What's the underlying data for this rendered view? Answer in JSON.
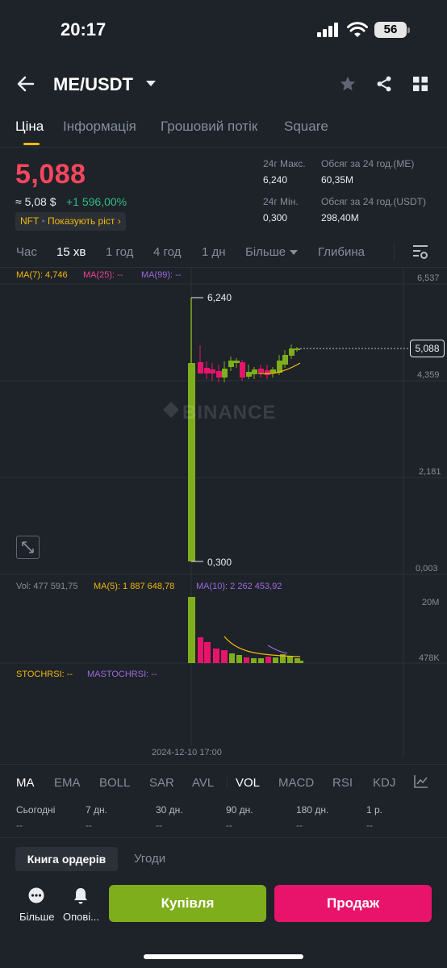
{
  "status": {
    "time": "20:17",
    "battery": "56"
  },
  "header": {
    "pair": "ME/USDT"
  },
  "tabs": [
    "Ціна",
    "Інформація",
    "Грошовий потік",
    "Square"
  ],
  "price": {
    "last": "5,088",
    "fiat": "≈ 5,08 $",
    "change": "+1 596,00%",
    "nft_tag": "NFT",
    "nft_link": "Показують ріст",
    "color_down": "#f6465d",
    "color_up": "#2ebd85"
  },
  "stats": {
    "high_label": "24г Макс.",
    "high_value": "6,240",
    "low_label": "24г Мін.",
    "low_value": "0,300",
    "vol_me_label": "Обсяг за 24 год.(ME)",
    "vol_me_value": "60,35M",
    "vol_usdt_label": "Обсяг за 24 год.(USDT)",
    "vol_usdt_value": "298,40M"
  },
  "timeframes": [
    "Час",
    "15 хв",
    "1 год",
    "4 год",
    "1 дн",
    "Більше",
    "Глибина"
  ],
  "ma": {
    "ma7": "MA(7): 4,746",
    "ma25": "MA(25): --",
    "ma99": "MA(99): --"
  },
  "price_axis": [
    "6,537",
    "4,359",
    "2,181",
    "0,003"
  ],
  "chart_marks": {
    "high": "6,240",
    "low": "0,300",
    "last": "5,088",
    "watermark": "BINANCE"
  },
  "volume": {
    "vol": "Vol: 477 591,75",
    "ma5": "MA(5): 1 887 648,78",
    "ma10": "MA(10): 2 262 453,92",
    "axis_top": "20M",
    "axis_bottom": "478K"
  },
  "stoch": {
    "stochrsi": "STOCHRSI: --",
    "mastochrsi": "MASTOCHRSI: --"
  },
  "date_label": "2024-12-10 17:00",
  "indicators": [
    "MA",
    "EMA",
    "BOLL",
    "SAR",
    "AVL",
    "VOL",
    "MACD",
    "RSI",
    "KDJ"
  ],
  "performance": {
    "labels": [
      "Сьогодні",
      "7 дн.",
      "30 дн.",
      "90 дн.",
      "180 дн.",
      "1 р."
    ],
    "values": [
      "--",
      "--",
      "--",
      "--",
      "--",
      "--"
    ]
  },
  "bottom_tabs": {
    "orderbook": "Книга ордерів",
    "trades": "Угоди"
  },
  "actions": {
    "more": "Більше",
    "alerts": "Опові...",
    "buy": "Купівля",
    "sell": "Продаж"
  },
  "colors": {
    "buy": "#7fae1d",
    "sell": "#e8146c",
    "accent": "#f0b90b",
    "ma7": "#f0b90b",
    "ma25": "#e84393",
    "ma99": "#9c6ade"
  }
}
